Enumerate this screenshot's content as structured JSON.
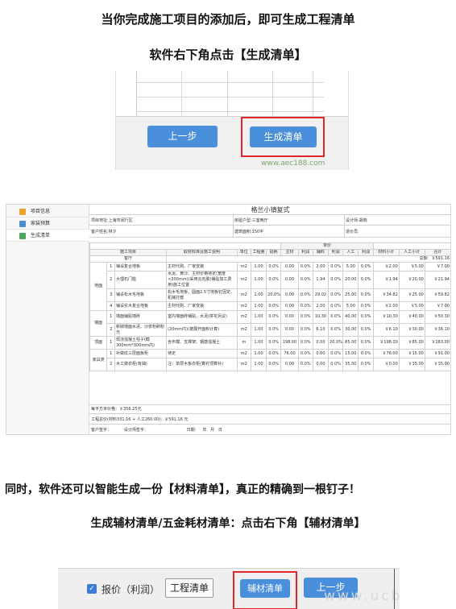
{
  "captions": {
    "c1": "当你完成施工项目的添加后，即可生成工程清单",
    "c2": "软件右下角点击【生成清单】",
    "c3": "同时，软件还可以智能生成一份【材料清单】，真正的精确到一根钉子！",
    "c4": "生成辅材清单/五金耗材清单：点击右下角【辅材清单】"
  },
  "shot1": {
    "prev_label": "上一步",
    "generate_label": "生成清单",
    "watermark": "www.aec188.com",
    "highlight_color": "#e0262a",
    "button_color": "#4a8fdc"
  },
  "shot2": {
    "nav": [
      "项目信息",
      "家装预算",
      "生成清单"
    ],
    "title": "格兰小镇复式",
    "info": {
      "address": "项目地址:上海市闵行区",
      "room": "房屋户型:三室两厅",
      "designer": "设计师:胡晓",
      "customer": "客户姓名:林夕",
      "area": "建筑面积:150平",
      "builder": "造价员:"
    },
    "headers": {
      "unit_price_group": "单价",
      "project": "施工项目",
      "material": "取材标准及施工说明",
      "unit": "单位",
      "qty": "工程量",
      "loss": "损耗",
      "main": "主材",
      "profit1": "利润",
      "aux": "辅料",
      "profit2": "利润",
      "labor": "人工",
      "profit3": "利润",
      "mat_sub": "材料小计",
      "labor_sub": "人工小计",
      "total": "合计"
    },
    "room_label": "客厅",
    "room_total": "总额：￥591.16",
    "groups": [
      {
        "name": "地面",
        "rows": [
          {
            "no": "1",
            "item": "铺设复合地板",
            "desc": "主材代购、厂家安装",
            "unit": "m2",
            "qty": "1.00",
            "loss": "0.0%",
            "main": "0.00",
            "p1": "0.0%",
            "aux": "2.00",
            "p2": "0.0%",
            "labor": "5.00",
            "p3": "0.0%",
            "mat": "￥2.00",
            "lab": "￥5.00",
            "total": "￥7.00"
          },
          {
            "no": "2",
            "item": "大理石门槛",
            "desc": "水泥、黄沙、主材价格待定(宽度<300mm)(采用云石胶)铺贴加工费用)施工位置",
            "unit": "m2",
            "qty": "1.00",
            "loss": "0.0%",
            "main": "0.00",
            "p1": "0.0%",
            "aux": "1.94",
            "p2": "0.0%",
            "labor": "20.00",
            "p3": "0.0%",
            "mat": "￥1.94",
            "lab": "￥20.00",
            "total": "￥21.94"
          },
          {
            "no": "3",
            "item": "铺设松木毛地板",
            "desc": "松木毛地板，圆面2.5寸地板钉固定、机械打磨",
            "unit": "m2",
            "qty": "1.00",
            "loss": "20.0%",
            "main": "0.00",
            "p1": "0.0%",
            "aux": "29.02",
            "p2": "0.0%",
            "labor": "25.00",
            "p3": "0.0%",
            "mat": "￥34.82",
            "lab": "￥25.00",
            "total": "￥59.82"
          },
          {
            "no": "4",
            "item": "铺设实木复合地板",
            "desc": "主材代购、厂家安装",
            "unit": "m2",
            "qty": "1.00",
            "loss": "0.0%",
            "main": "0.00",
            "p1": "0.0%",
            "aux": "2.00",
            "p2": "0.0%",
            "labor": "5.00",
            "p3": "0.0%",
            "mat": "￥2.00",
            "lab": "￥5.00",
            "total": "￥7.00"
          }
        ]
      },
      {
        "name": "墙面",
        "rows": [
          {
            "no": "1",
            "item": "墙面铺贴墙砖",
            "desc": "室内墙面砖铺贴，水泥(拼花另议)",
            "unit": "m2",
            "qty": "1.00",
            "loss": "0.0%",
            "main": "0.00",
            "p1": "0.0%",
            "aux": "10.30",
            "p2": "0.0%",
            "labor": "40.00",
            "p3": "0.0%",
            "mat": "￥10.30",
            "lab": "￥40.00",
            "total": "￥50.30"
          },
          {
            "no": "2",
            "item": "新砌墙面水泥、沙浆粉刷粉光",
            "desc": "(20mm内)(按展开面积计算)",
            "unit": "m2",
            "qty": "1.00",
            "loss": "0.0%",
            "main": "0.00",
            "p1": "0.0%",
            "aux": "6.10",
            "p2": "0.0%",
            "labor": "30.00",
            "p3": "0.0%",
            "mat": "￥6.10",
            "lab": "￥30.00",
            "total": "￥36.10"
          }
        ]
      },
      {
        "name": "顶面",
        "rows": [
          {
            "no": "1",
            "item": "现浇混凝土柱子(截300mm*300mm内)",
            "desc": "含布模、支撑架、钢筋混凝土",
            "unit": "m",
            "qty": "1.00",
            "loss": "0.0%",
            "main": "198.00",
            "p1": "0.0%",
            "aux": "0.00",
            "p2": "20.0%",
            "labor": "85.00",
            "p3": "0.0%",
            "mat": "￥198.00",
            "lab": "￥85.00",
            "total": "￥283.00"
          }
        ]
      },
      {
        "name": "家具类",
        "rows": [
          {
            "no": "1",
            "item": "补做纹三层面板柜",
            "desc": "待定",
            "unit": "m2",
            "qty": "1.00",
            "loss": "0.0%",
            "main": "76.00",
            "p1": "0.0%",
            "aux": "0.00",
            "p2": "0.0%",
            "labor": "15.00",
            "p3": "0.0%",
            "mat": "￥76.00",
            "lab": "￥15.00",
            "total": "￥91.00"
          },
          {
            "no": "2",
            "item": "木工做衣柜(有抽)",
            "desc": "注：单层木板衣柜(算衬顶算补)",
            "unit": "m2",
            "qty": "1.00",
            "loss": "0.0%",
            "main": "0.00",
            "p1": "0.0%",
            "aux": "0.00",
            "p2": "0.0%",
            "labor": "35.00",
            "p3": "0.0%",
            "mat": "￥0.00",
            "lab": "￥35.00",
            "total": "￥35.00"
          }
        ]
      }
    ],
    "per_sqm": "每平方米价格：￥356.25元",
    "grand_total": "工程总价(材料331.16 + 人工260.00)：￥591.16 元",
    "sign": "客户签字：          设计师签字：                              日期：   年   月   日"
  },
  "shot3": {
    "quote_label": "报价（利润）",
    "project_list_label": "工程清单",
    "aux_list_label": "辅材清单",
    "prev_label": "上一步",
    "watermark": "www.ucb",
    "highlight_color": "#e0262a"
  }
}
